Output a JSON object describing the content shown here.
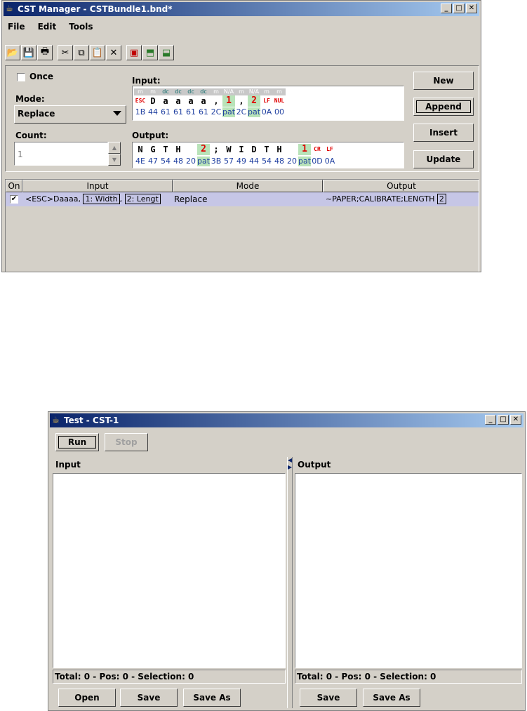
{
  "cst_window": {
    "title": "CST Manager - CSTBundle1.bnd*",
    "controls": {
      "minimize": "_",
      "maximize": "□",
      "close": "✕"
    },
    "menu": [
      "File",
      "Edit",
      "Tools"
    ],
    "toolbar_icons": [
      "open-icon",
      "save-icon",
      "print-icon",
      "cut-icon",
      "copy-icon",
      "paste-icon",
      "delete-icon",
      "test-icon",
      "import-icon",
      "export-icon"
    ],
    "once_label": "Once",
    "mode_label": "Mode:",
    "mode_value": "Replace",
    "count_label": "Count:",
    "count_value": "1",
    "input_label": "Input:",
    "output_label": "Output:",
    "buttons": {
      "new": "New",
      "append": "Append",
      "insert": "Insert",
      "update": "Update"
    },
    "input_seq": {
      "tags": [
        "m",
        "m",
        "dc",
        "dc",
        "dc",
        "dc",
        "m",
        "N/A",
        "m",
        "N/A",
        "m",
        "m"
      ],
      "chars": [
        "ESC",
        "D",
        "a",
        "a",
        "a",
        "a",
        ",",
        "1",
        ",",
        "2",
        "LF",
        "NUL"
      ],
      "hex": [
        "1B",
        "44",
        "61",
        "61",
        "61",
        "61",
        "2C",
        "pat",
        "2C",
        "pat",
        "0A",
        "00"
      ]
    },
    "output_seq": {
      "chars": [
        "N",
        "G",
        "T",
        "H",
        " ",
        "2",
        ";",
        "W",
        "I",
        "D",
        "T",
        "H",
        " ",
        "1",
        "CR",
        "LF"
      ],
      "hex": [
        "4E",
        "47",
        "54",
        "48",
        "20",
        "pat",
        "3B",
        "57",
        "49",
        "44",
        "54",
        "48",
        "20",
        "pat",
        "0D",
        "0A"
      ]
    },
    "table": {
      "headers": [
        "On",
        "Input",
        "Mode",
        "Output"
      ],
      "row": {
        "input_prefix": "<ESC>Daaaa,",
        "input_pat1": "1: Width",
        "input_sep": ",",
        "input_pat2": "2: Lengt",
        "mode": "Replace",
        "output_text": "~PAPER;CALIBRATE;LENGTH",
        "output_pat": "2"
      }
    }
  },
  "test_window": {
    "title": "Test - CST-1",
    "controls": {
      "minimize": "_",
      "maximize": "□",
      "close": "✕"
    },
    "run_label": "Run",
    "stop_label": "Stop",
    "input_header": "Input",
    "output_header": "Output",
    "input_status": "Total: 0 - Pos: 0 - Selection: 0",
    "output_status": "Total: 0 - Pos: 0 - Selection: 0",
    "input_buttons": {
      "open": "Open",
      "save": "Save",
      "save_as": "Save As"
    },
    "output_buttons": {
      "save": "Save",
      "save_as": "Save As"
    }
  }
}
